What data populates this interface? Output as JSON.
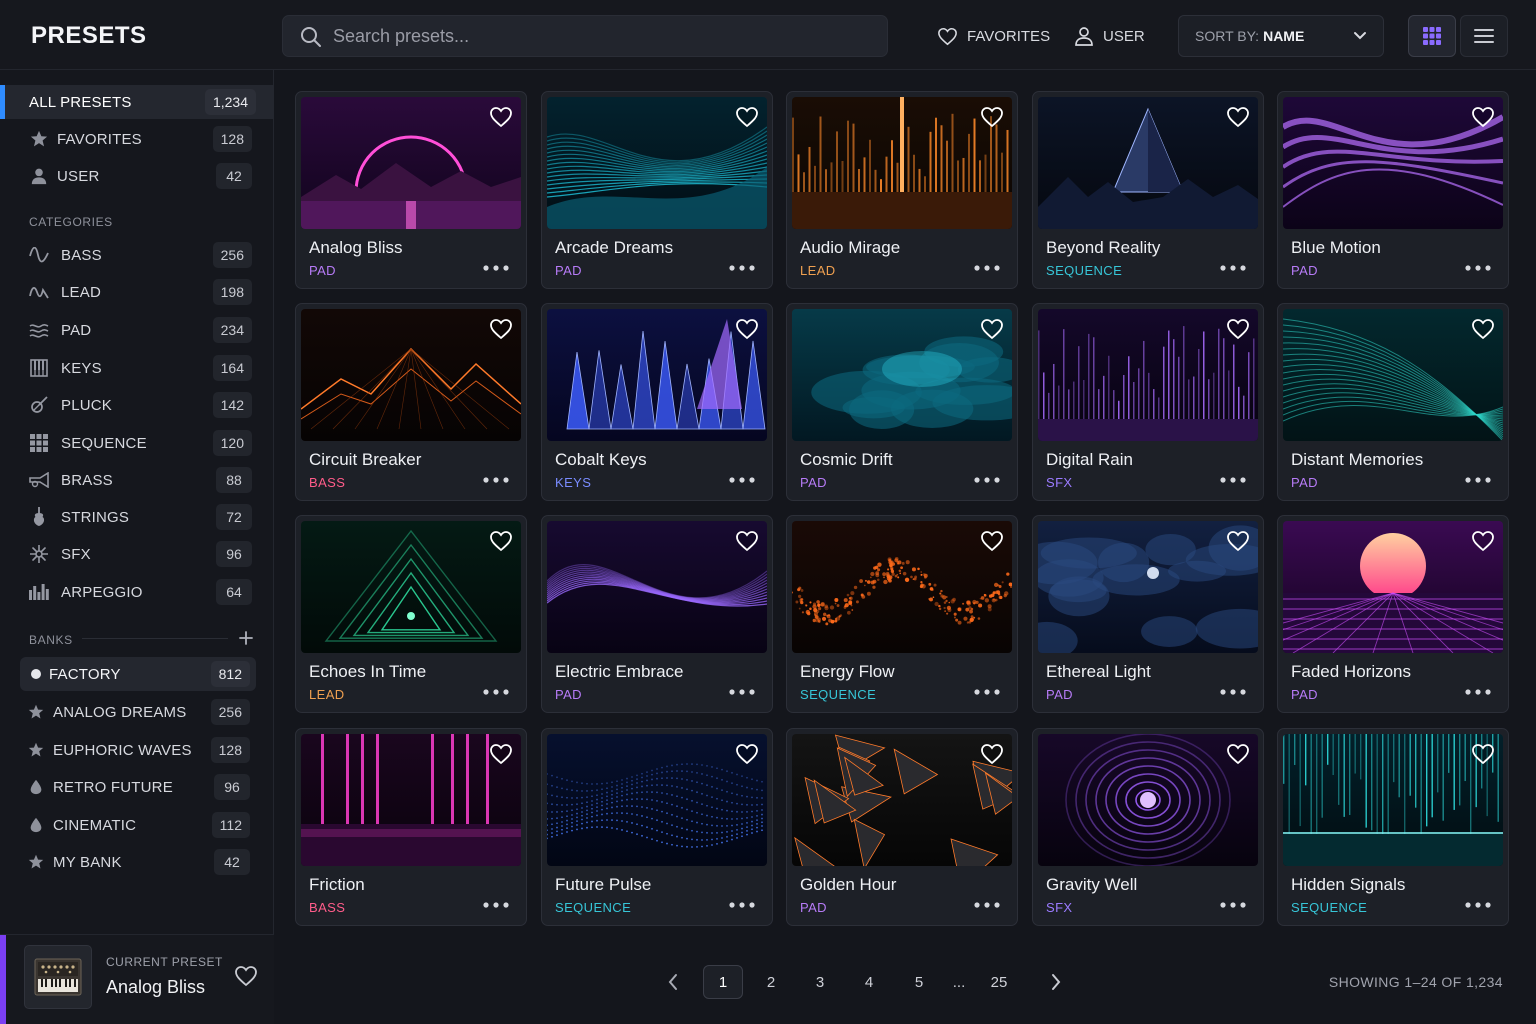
{
  "app": {
    "title": "PRESETS"
  },
  "search": {
    "placeholder": "Search presets..."
  },
  "toolbar": {
    "favorites_label": "FAVORITES",
    "user_label": "USER",
    "sort_prefix": "SORT BY:",
    "sort_value": "NAME",
    "view_mode": "grid"
  },
  "sidebar": {
    "top": [
      {
        "label": "ALL PRESETS",
        "count": "1,234",
        "icon": "none",
        "active": true
      },
      {
        "label": "FAVORITES",
        "count": "128",
        "icon": "star-icon"
      },
      {
        "label": "USER",
        "count": "42",
        "icon": "user-icon"
      }
    ],
    "categories_title": "CATEGORIES",
    "categories": [
      {
        "label": "BASS",
        "count": "256",
        "icon": "bass-wave-icon"
      },
      {
        "label": "LEAD",
        "count": "198",
        "icon": "lead-wave-icon"
      },
      {
        "label": "PAD",
        "count": "234",
        "icon": "pad-waves-icon"
      },
      {
        "label": "KEYS",
        "count": "164",
        "icon": "keys-icon"
      },
      {
        "label": "PLUCK",
        "count": "142",
        "icon": "pluck-icon"
      },
      {
        "label": "SEQUENCE",
        "count": "120",
        "icon": "sequence-grid-icon"
      },
      {
        "label": "BRASS",
        "count": "88",
        "icon": "brass-horn-icon"
      },
      {
        "label": "STRINGS",
        "count": "72",
        "icon": "violin-icon"
      },
      {
        "label": "SFX",
        "count": "96",
        "icon": "sparkle-icon"
      },
      {
        "label": "ARPEGGIO",
        "count": "64",
        "icon": "arpeggio-bars-icon"
      }
    ],
    "banks_title": "BANKS",
    "banks": [
      {
        "label": "FACTORY",
        "count": "812",
        "icon": "dot-icon",
        "active": true
      },
      {
        "label": "ANALOG DREAMS",
        "count": "256",
        "icon": "star-icon"
      },
      {
        "label": "EUPHORIC WAVES",
        "count": "128",
        "icon": "star-icon"
      },
      {
        "label": "RETRO FUTURE",
        "count": "96",
        "icon": "drop-icon"
      },
      {
        "label": "CINEMATIC",
        "count": "112",
        "icon": "drop-icon"
      },
      {
        "label": "MY BANK",
        "count": "42",
        "icon": "star-icon"
      }
    ]
  },
  "current_preset": {
    "label": "CURRENT PRESET",
    "name": "Analog Bliss",
    "icon": "synthesizer-icon"
  },
  "colors": {
    "accent_blue": "#2f8cff",
    "accent_purple": "#7b3ff2",
    "cat_pad": "#b77bf7",
    "cat_lead": "#f0a050",
    "cat_sequence": "#37c6d8",
    "cat_bass": "#ff5c8a",
    "cat_keys": "#7a8cff",
    "cat_sfx": "#9b7bff"
  },
  "presets": [
    {
      "name": "Analog Bliss",
      "category": "PAD",
      "art": "neon-arch-mountains"
    },
    {
      "name": "Arcade Dreams",
      "category": "PAD",
      "art": "teal-wave-lines"
    },
    {
      "name": "Audio Mirage",
      "category": "LEAD",
      "art": "orange-light-bars"
    },
    {
      "name": "Beyond Reality",
      "category": "SEQUENCE",
      "art": "crystal-pyramid"
    },
    {
      "name": "Blue Motion",
      "category": "PAD",
      "art": "purple-silk"
    },
    {
      "name": "Circuit Breaker",
      "category": "BASS",
      "art": "orange-wire-mountains"
    },
    {
      "name": "Cobalt Keys",
      "category": "KEYS",
      "art": "blue-crystals"
    },
    {
      "name": "Cosmic Drift",
      "category": "PAD",
      "art": "teal-clouds"
    },
    {
      "name": "Digital Rain",
      "category": "SFX",
      "art": "purple-light-bars"
    },
    {
      "name": "Distant Memories",
      "category": "PAD",
      "art": "teal-swirl-lines"
    },
    {
      "name": "Echoes In Time",
      "category": "LEAD",
      "art": "green-triangles"
    },
    {
      "name": "Electric Embrace",
      "category": "PAD",
      "art": "purple-wave"
    },
    {
      "name": "Energy Flow",
      "category": "SEQUENCE",
      "art": "orange-particles"
    },
    {
      "name": "Ethereal Light",
      "category": "PAD",
      "art": "blue-night-clouds"
    },
    {
      "name": "Faded Horizons",
      "category": "PAD",
      "art": "synthwave-sun"
    },
    {
      "name": "Friction",
      "category": "BASS",
      "art": "pink-neon-corridor"
    },
    {
      "name": "Future Pulse",
      "category": "SEQUENCE",
      "art": "blue-dot-wave"
    },
    {
      "name": "Golden Hour",
      "category": "PAD",
      "art": "orange-polygons"
    },
    {
      "name": "Gravity Well",
      "category": "SFX",
      "art": "purple-vortex"
    },
    {
      "name": "Hidden Signals",
      "category": "SEQUENCE",
      "art": "teal-light-rain"
    }
  ],
  "pagination": {
    "prev_icon": "chevron-left-icon",
    "pages": [
      "1",
      "2",
      "3",
      "4",
      "5",
      "...",
      "25"
    ],
    "current": "1",
    "next_icon": "chevron-right-icon",
    "showing": "SHOWING 1–24 OF 1,234"
  }
}
